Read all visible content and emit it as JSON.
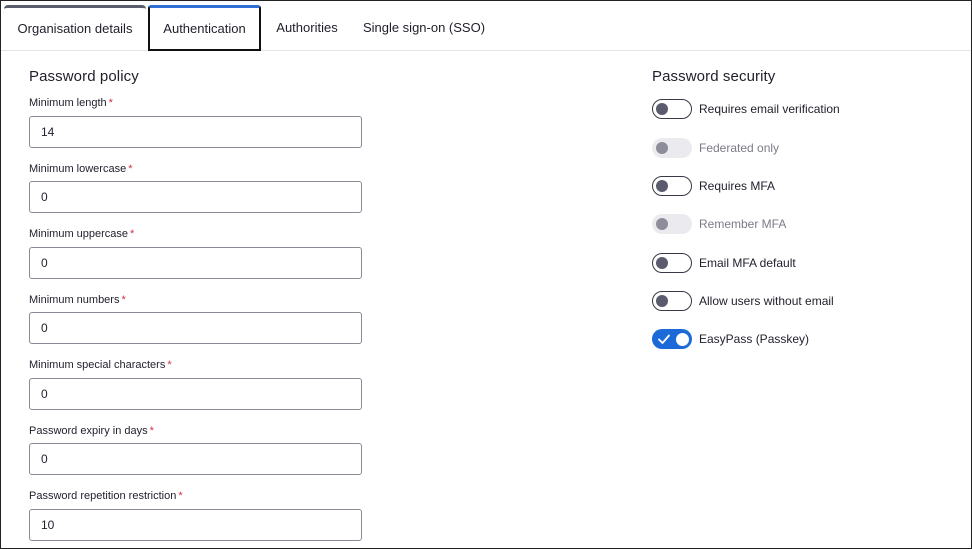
{
  "tabs": [
    {
      "label": "Organisation details",
      "active": false
    },
    {
      "label": "Authentication",
      "active": true
    },
    {
      "label": "Authorities",
      "active": false
    },
    {
      "label": "Single sign-on (SSO)",
      "active": false
    }
  ],
  "password_policy": {
    "title": "Password policy",
    "required_marker": "*",
    "fields": [
      {
        "label": "Minimum length",
        "value": "14"
      },
      {
        "label": "Minimum lowercase",
        "value": "0"
      },
      {
        "label": "Minimum uppercase",
        "value": "0"
      },
      {
        "label": "Minimum numbers",
        "value": "0"
      },
      {
        "label": "Minimum special characters",
        "value": "0"
      },
      {
        "label": "Password expiry in days",
        "value": "0"
      },
      {
        "label": "Password repetition restriction",
        "value": "10"
      }
    ]
  },
  "password_security": {
    "title": "Password security",
    "toggles": [
      {
        "label": "Requires email verification",
        "on": false,
        "disabled": false
      },
      {
        "label": "Federated only",
        "on": false,
        "disabled": true
      },
      {
        "label": "Requires MFA",
        "on": false,
        "disabled": false
      },
      {
        "label": "Remember MFA",
        "on": false,
        "disabled": true
      },
      {
        "label": "Email MFA default",
        "on": false,
        "disabled": false
      },
      {
        "label": "Allow users without email",
        "on": false,
        "disabled": false
      },
      {
        "label": "EasyPass (Passkey)",
        "on": true,
        "disabled": false
      }
    ]
  },
  "colors": {
    "accent": "#1c6ad8",
    "required": "#d0304a",
    "toggle_off_knob": "#5b5b6e",
    "disabled_track": "#ebebef"
  },
  "icons": {
    "check": "check-icon"
  }
}
